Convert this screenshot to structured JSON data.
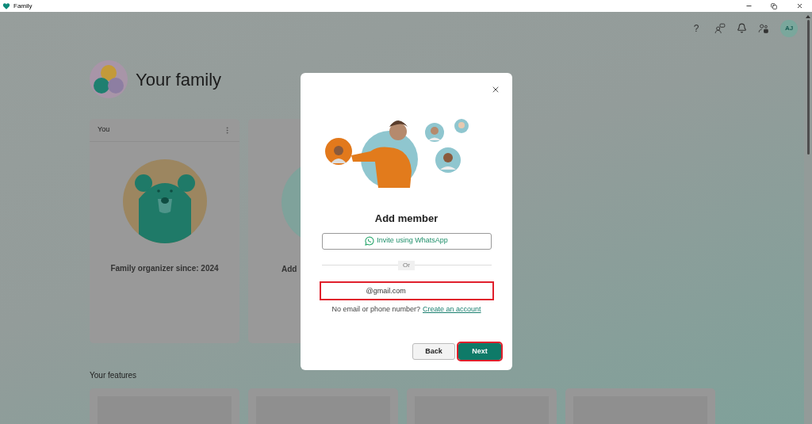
{
  "window": {
    "title": "Family"
  },
  "header": {
    "help": "?",
    "avatar": "AJ"
  },
  "page": {
    "title": "Your family"
  },
  "cards": [
    {
      "kind": "member",
      "header": "You",
      "caption": "Family organizer since: 2024"
    },
    {
      "kind": "add",
      "caption": "Add"
    }
  ],
  "features": {
    "title": "Your features"
  },
  "dialog": {
    "title": "Add member",
    "whatsapp_button": "Invite using WhatsApp",
    "divider": "Or",
    "email_field": {
      "value": "@gmail.com",
      "highlighted": true
    },
    "helper": "No email or phone number?",
    "link": "Create an account",
    "buttons": [
      {
        "kind": "secondary",
        "label": "Back",
        "highlighted": false
      },
      {
        "kind": "primary",
        "label": "Next",
        "highlighted": true
      }
    ]
  }
}
